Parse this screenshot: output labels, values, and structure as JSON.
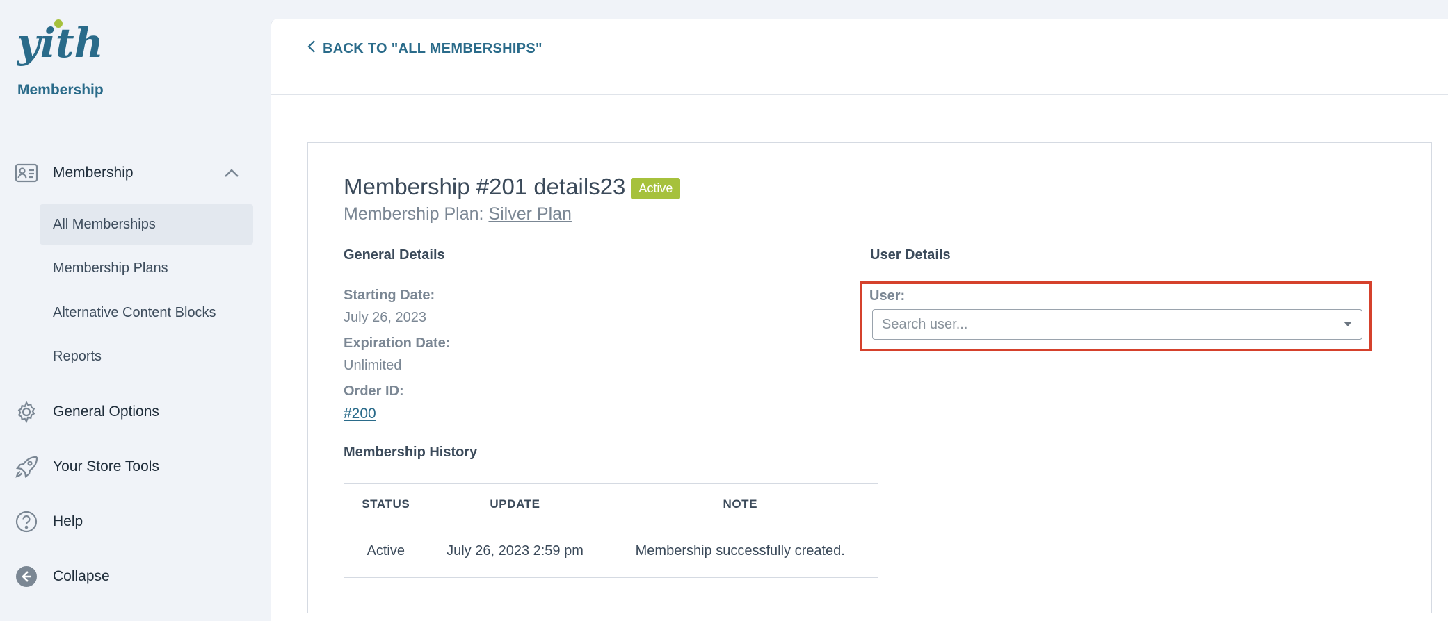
{
  "brand": {
    "logo_text": "yith",
    "product": "Membership"
  },
  "sidebar": {
    "membership_label": "Membership",
    "sub_items": [
      {
        "label": "All Memberships",
        "active": true
      },
      {
        "label": "Membership Plans"
      },
      {
        "label": "Alternative Content Blocks"
      },
      {
        "label": "Reports"
      }
    ],
    "general_options_label": "General Options",
    "store_tools_label": "Your Store Tools",
    "help_label": "Help",
    "collapse_label": "Collapse"
  },
  "topbar": {
    "back_label": "BACK TO \"ALL MEMBERSHIPS\""
  },
  "membership": {
    "title": "Membership #201 details23",
    "status_badge": "Active",
    "plan_prefix": "Membership Plan:",
    "plan_name": "Silver Plan"
  },
  "general_details": {
    "title": "General Details",
    "starting_date_label": "Starting Date:",
    "starting_date": "July 26, 2023",
    "expiration_date_label": "Expiration Date:",
    "expiration_date": "Unlimited",
    "order_id_label": "Order ID:",
    "order_id": "#200"
  },
  "user_details": {
    "title": "User Details",
    "user_label": "User:",
    "user_placeholder": "Search user..."
  },
  "history": {
    "title": "Membership History",
    "columns": [
      "STATUS",
      "UPDATE",
      "NOTE"
    ],
    "rows": [
      [
        "Active",
        "July 26, 2023 2:59 pm",
        "Membership successfully created."
      ]
    ]
  },
  "colors": {
    "accent": "#2a6b8a",
    "badge_green": "#a6c13c",
    "highlight_red": "#d5412c",
    "logo_green": "#a6c13c"
  }
}
